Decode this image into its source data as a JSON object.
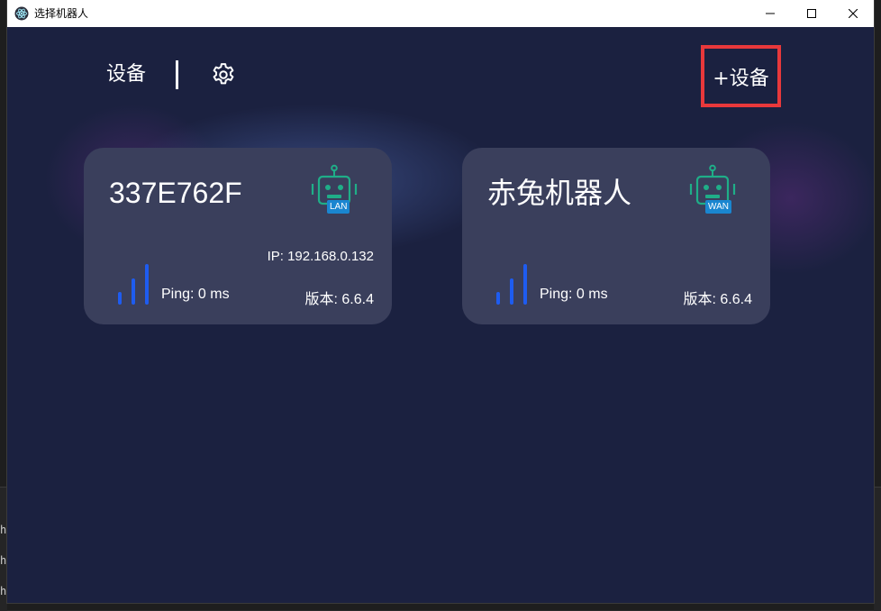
{
  "window": {
    "title": "选择机器人",
    "app_icon": "electron-atom-icon"
  },
  "nav": {
    "devices_label": "设备",
    "settings_icon": "gear-icon",
    "add_device_label": "+设备",
    "add_highlight_color": "#e8383b"
  },
  "devices": [
    {
      "name": "337E762F",
      "connection": "LAN",
      "ip": "IP: 192.168.0.132",
      "ping": "Ping: 0 ms",
      "version": "版本: 6.6.4",
      "signal_bars": 3
    },
    {
      "name": "赤兔机器人",
      "connection": "WAN",
      "ping": "Ping: 0 ms",
      "version": "版本: 6.6.4",
      "signal_bars": 3
    }
  ],
  "colors": {
    "background": "#1b2140",
    "card": "#3a3f5c",
    "robot_icon": "#1fae88",
    "badge": "#1a86d0",
    "signal": "#1e5cf0"
  }
}
